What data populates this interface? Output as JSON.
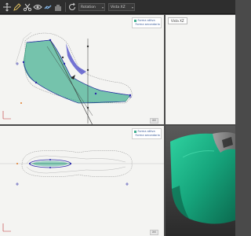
{
  "toolbar": {
    "icons": [
      "move-icon",
      "pencil-icon",
      "scissors-icon",
      "eye-icon",
      "link-icon",
      "hand-icon",
      "rotate-icon"
    ],
    "select_1": "Rotation",
    "select_2": "Vista XZ"
  },
  "viewports": {
    "top_left": {
      "legend": [
        "Forma attiva",
        "Forma secondaria"
      ],
      "corner_tag": "XX"
    },
    "top_right": {
      "label": "Vista XZ"
    },
    "bottom_left": {
      "legend": [
        "Forma attiva",
        "Forma secondaria"
      ],
      "corner_tag": "XX"
    }
  },
  "colors": {
    "shape_fill": "#3fae8f",
    "shape_fill_3d": "#1fb58a",
    "outline_blue": "#2a2aa8",
    "outline_gray": "#888888",
    "axis_orange": "#e07a2a",
    "viewport_bg": "#f4f4f2",
    "toolbar_bg": "#2e2e2e",
    "legend_text": "#3a5b9a"
  }
}
